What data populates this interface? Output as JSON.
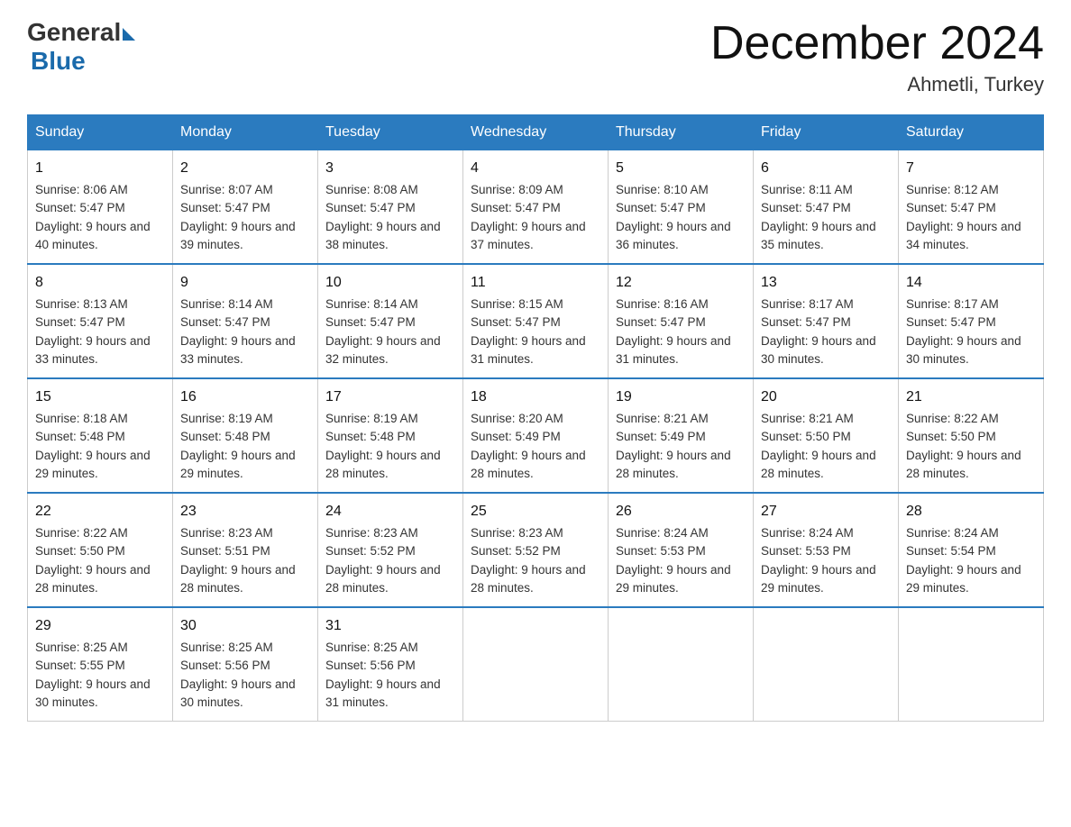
{
  "logo": {
    "general": "General",
    "blue": "Blue"
  },
  "title": "December 2024",
  "location": "Ahmetli, Turkey",
  "days_header": [
    "Sunday",
    "Monday",
    "Tuesday",
    "Wednesday",
    "Thursday",
    "Friday",
    "Saturday"
  ],
  "weeks": [
    [
      {
        "day": "1",
        "sunrise": "8:06 AM",
        "sunset": "5:47 PM",
        "daylight": "9 hours and 40 minutes."
      },
      {
        "day": "2",
        "sunrise": "8:07 AM",
        "sunset": "5:47 PM",
        "daylight": "9 hours and 39 minutes."
      },
      {
        "day": "3",
        "sunrise": "8:08 AM",
        "sunset": "5:47 PM",
        "daylight": "9 hours and 38 minutes."
      },
      {
        "day": "4",
        "sunrise": "8:09 AM",
        "sunset": "5:47 PM",
        "daylight": "9 hours and 37 minutes."
      },
      {
        "day": "5",
        "sunrise": "8:10 AM",
        "sunset": "5:47 PM",
        "daylight": "9 hours and 36 minutes."
      },
      {
        "day": "6",
        "sunrise": "8:11 AM",
        "sunset": "5:47 PM",
        "daylight": "9 hours and 35 minutes."
      },
      {
        "day": "7",
        "sunrise": "8:12 AM",
        "sunset": "5:47 PM",
        "daylight": "9 hours and 34 minutes."
      }
    ],
    [
      {
        "day": "8",
        "sunrise": "8:13 AM",
        "sunset": "5:47 PM",
        "daylight": "9 hours and 33 minutes."
      },
      {
        "day": "9",
        "sunrise": "8:14 AM",
        "sunset": "5:47 PM",
        "daylight": "9 hours and 33 minutes."
      },
      {
        "day": "10",
        "sunrise": "8:14 AM",
        "sunset": "5:47 PM",
        "daylight": "9 hours and 32 minutes."
      },
      {
        "day": "11",
        "sunrise": "8:15 AM",
        "sunset": "5:47 PM",
        "daylight": "9 hours and 31 minutes."
      },
      {
        "day": "12",
        "sunrise": "8:16 AM",
        "sunset": "5:47 PM",
        "daylight": "9 hours and 31 minutes."
      },
      {
        "day": "13",
        "sunrise": "8:17 AM",
        "sunset": "5:47 PM",
        "daylight": "9 hours and 30 minutes."
      },
      {
        "day": "14",
        "sunrise": "8:17 AM",
        "sunset": "5:47 PM",
        "daylight": "9 hours and 30 minutes."
      }
    ],
    [
      {
        "day": "15",
        "sunrise": "8:18 AM",
        "sunset": "5:48 PM",
        "daylight": "9 hours and 29 minutes."
      },
      {
        "day": "16",
        "sunrise": "8:19 AM",
        "sunset": "5:48 PM",
        "daylight": "9 hours and 29 minutes."
      },
      {
        "day": "17",
        "sunrise": "8:19 AM",
        "sunset": "5:48 PM",
        "daylight": "9 hours and 28 minutes."
      },
      {
        "day": "18",
        "sunrise": "8:20 AM",
        "sunset": "5:49 PM",
        "daylight": "9 hours and 28 minutes."
      },
      {
        "day": "19",
        "sunrise": "8:21 AM",
        "sunset": "5:49 PM",
        "daylight": "9 hours and 28 minutes."
      },
      {
        "day": "20",
        "sunrise": "8:21 AM",
        "sunset": "5:50 PM",
        "daylight": "9 hours and 28 minutes."
      },
      {
        "day": "21",
        "sunrise": "8:22 AM",
        "sunset": "5:50 PM",
        "daylight": "9 hours and 28 minutes."
      }
    ],
    [
      {
        "day": "22",
        "sunrise": "8:22 AM",
        "sunset": "5:50 PM",
        "daylight": "9 hours and 28 minutes."
      },
      {
        "day": "23",
        "sunrise": "8:23 AM",
        "sunset": "5:51 PM",
        "daylight": "9 hours and 28 minutes."
      },
      {
        "day": "24",
        "sunrise": "8:23 AM",
        "sunset": "5:52 PM",
        "daylight": "9 hours and 28 minutes."
      },
      {
        "day": "25",
        "sunrise": "8:23 AM",
        "sunset": "5:52 PM",
        "daylight": "9 hours and 28 minutes."
      },
      {
        "day": "26",
        "sunrise": "8:24 AM",
        "sunset": "5:53 PM",
        "daylight": "9 hours and 29 minutes."
      },
      {
        "day": "27",
        "sunrise": "8:24 AM",
        "sunset": "5:53 PM",
        "daylight": "9 hours and 29 minutes."
      },
      {
        "day": "28",
        "sunrise": "8:24 AM",
        "sunset": "5:54 PM",
        "daylight": "9 hours and 29 minutes."
      }
    ],
    [
      {
        "day": "29",
        "sunrise": "8:25 AM",
        "sunset": "5:55 PM",
        "daylight": "9 hours and 30 minutes."
      },
      {
        "day": "30",
        "sunrise": "8:25 AM",
        "sunset": "5:56 PM",
        "daylight": "9 hours and 30 minutes."
      },
      {
        "day": "31",
        "sunrise": "8:25 AM",
        "sunset": "5:56 PM",
        "daylight": "9 hours and 31 minutes."
      },
      null,
      null,
      null,
      null
    ]
  ],
  "labels": {
    "sunrise_prefix": "Sunrise: ",
    "sunset_prefix": "Sunset: ",
    "daylight_prefix": "Daylight: "
  }
}
